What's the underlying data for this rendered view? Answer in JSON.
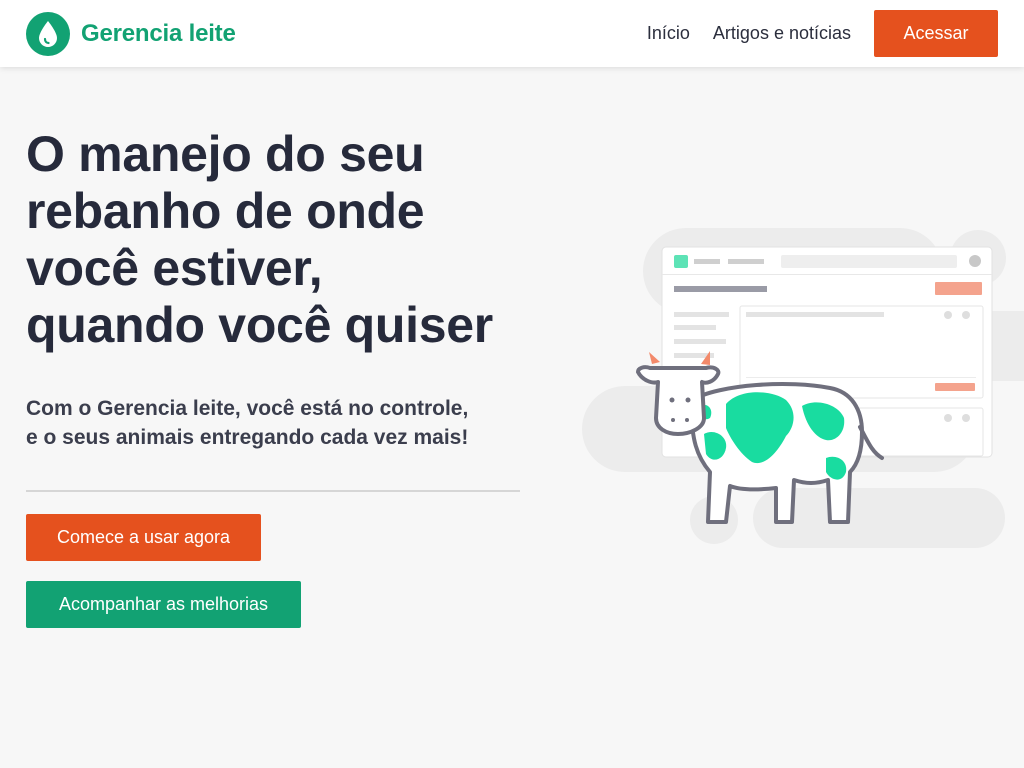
{
  "brand": {
    "name": "Gerencia leite",
    "color": "#12a273",
    "icon": "milk-drop-icon"
  },
  "nav": {
    "links": [
      "Início",
      "Artigos e notícias"
    ],
    "cta": "Acessar"
  },
  "hero": {
    "title_lines": [
      "O manejo do seu",
      "rebanho de onde",
      "você estiver,",
      "quando você quiser"
    ],
    "subtitle_lines": [
      "Com o Gerencia leite, você está no controle,",
      "e o seus animais entregando cada vez mais!"
    ],
    "primary_cta": "Comece a usar agora",
    "secondary_cta": "Acompanhar as melhorias"
  },
  "colors": {
    "accent_orange": "#e5511e",
    "accent_green": "#12a273",
    "cow_spots": "#19dca0",
    "text_dark": "#262a3b"
  },
  "illustration": {
    "icon": "cow-dashboard-illustration"
  }
}
